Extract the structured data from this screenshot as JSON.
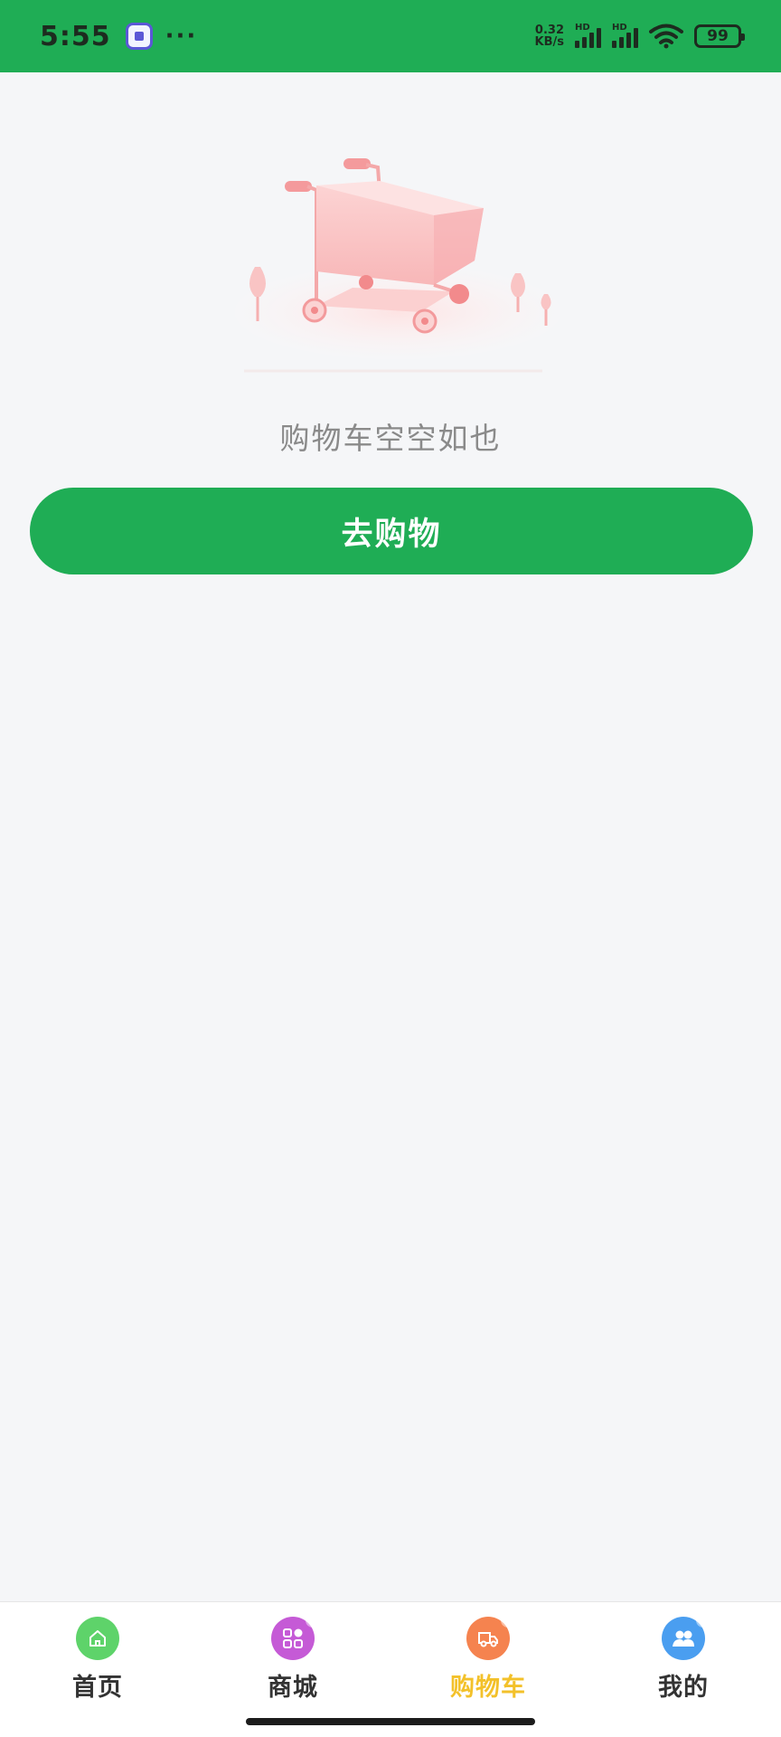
{
  "status_bar": {
    "time": "5:55",
    "net_speed_value": "0.32",
    "net_speed_unit": "KB/s",
    "signal_label_1": "HD",
    "signal_label_2": "HD",
    "battery": "99"
  },
  "empty_state": {
    "message": "购物车空空如也",
    "button_label": "去购物"
  },
  "tab_bar": {
    "items": [
      {
        "label": "首页",
        "icon": "home-icon",
        "color": "#5ed36a",
        "active": false
      },
      {
        "label": "商城",
        "icon": "grid-icon",
        "color": "#c55ad6",
        "active": false
      },
      {
        "label": "购物车",
        "icon": "truck-icon",
        "color": "#f5834f",
        "active": true
      },
      {
        "label": "我的",
        "icon": "users-icon",
        "color": "#4a9ef0",
        "active": false
      }
    ]
  },
  "colors": {
    "brand_green": "#1fad55",
    "active_tab": "#f3c12a",
    "background": "#f5f6f8"
  }
}
